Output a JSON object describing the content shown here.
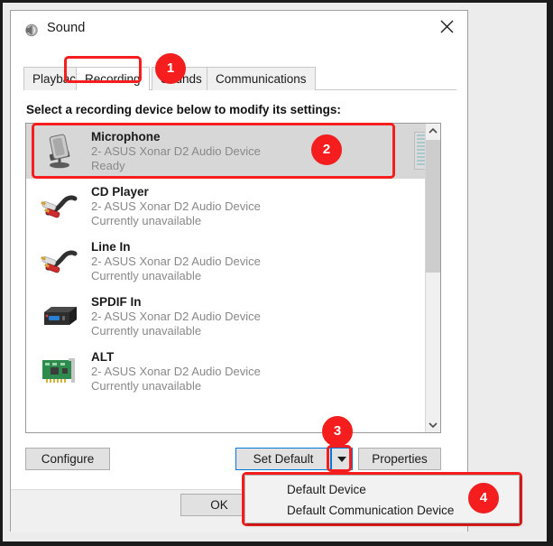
{
  "window": {
    "title": "Sound",
    "icon": "speaker-icon",
    "close_label": "✕"
  },
  "tabs": [
    {
      "label": "Playback",
      "active": false
    },
    {
      "label": "Recording",
      "active": true
    },
    {
      "label": "Sounds",
      "active": false
    },
    {
      "label": "Communications",
      "active": false
    }
  ],
  "instruction": "Select a recording device below to modify its settings:",
  "devices": [
    {
      "name": "Microphone",
      "subtitle": "2- ASUS Xonar D2 Audio Device",
      "status": "Ready",
      "icon": "microphone-icon",
      "selected": true,
      "meter": true
    },
    {
      "name": "CD Player",
      "subtitle": "2- ASUS Xonar D2 Audio Device",
      "status": "Currently unavailable",
      "icon": "rca-cable-icon",
      "selected": false,
      "meter": false
    },
    {
      "name": "Line In",
      "subtitle": "2- ASUS Xonar D2 Audio Device",
      "status": "Currently unavailable",
      "icon": "rca-cable-icon",
      "selected": false,
      "meter": false
    },
    {
      "name": "SPDIF In",
      "subtitle": "2- ASUS Xonar D2 Audio Device",
      "status": "Currently unavailable",
      "icon": "spdif-box-icon",
      "selected": false,
      "meter": false
    },
    {
      "name": "ALT",
      "subtitle": "2- ASUS Xonar D2 Audio Device",
      "status": "Currently unavailable",
      "icon": "pci-card-icon",
      "selected": false,
      "meter": false
    }
  ],
  "buttons": {
    "configure": "Configure",
    "set_default": "Set Default",
    "set_default_arrow": "▼",
    "properties": "Properties",
    "ok": "OK"
  },
  "dropdown_menu": {
    "items": [
      {
        "label": "Default Device"
      },
      {
        "label": "Default Communication Device"
      }
    ]
  },
  "annotations": {
    "badges": [
      {
        "number": "1"
      },
      {
        "number": "2"
      },
      {
        "number": "3"
      },
      {
        "number": "4"
      }
    ],
    "accent_color": "#f51d1d"
  },
  "scrollbar": {
    "up_arrow": "⌃",
    "down_arrow": "⌄"
  }
}
